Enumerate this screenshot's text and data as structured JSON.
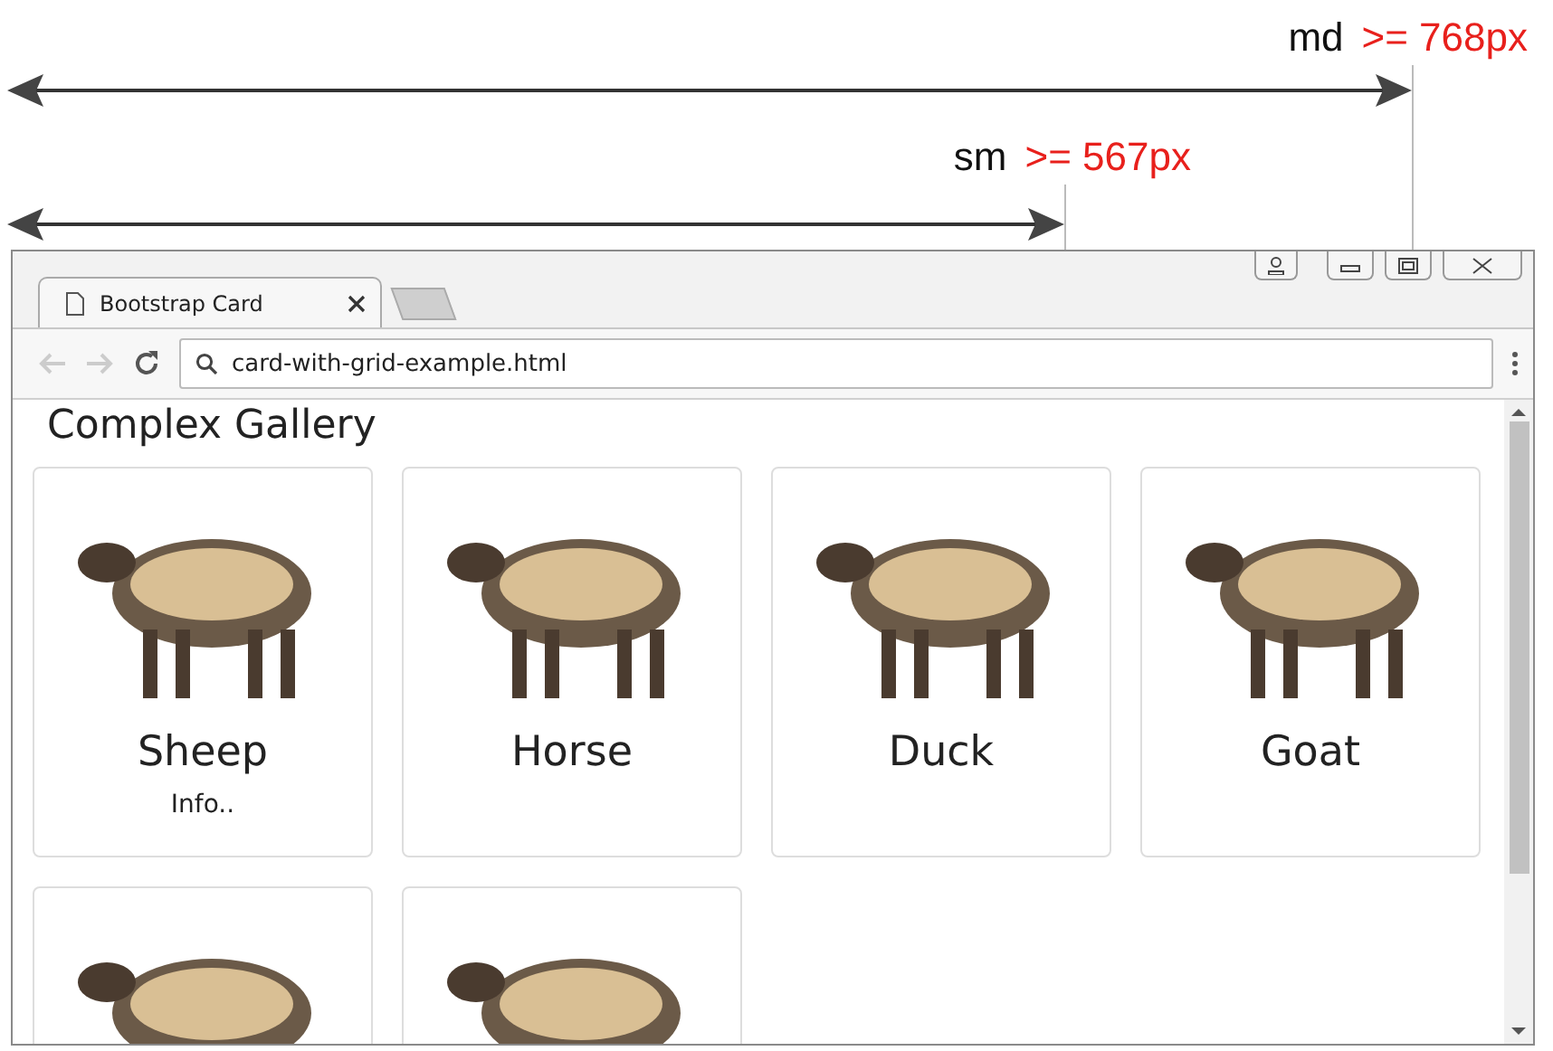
{
  "breakpoints": [
    {
      "name": "md",
      "value": ">= 768px",
      "kind": "md"
    },
    {
      "name": "sm",
      "value": ">= 567px",
      "kind": "sm"
    }
  ],
  "browser": {
    "tab": {
      "title": "Bootstrap Card"
    },
    "address": "card-with-grid-example.html"
  },
  "page": {
    "heading": "Complex Gallery",
    "cards": [
      {
        "kind": "titled",
        "title": "Sheep",
        "info": "Info.."
      },
      {
        "kind": "titled",
        "title": "Horse"
      },
      {
        "kind": "titled",
        "title": "Duck"
      },
      {
        "kind": "titled",
        "title": "Goat"
      },
      {
        "kind": "image"
      },
      {
        "kind": "image"
      }
    ]
  }
}
